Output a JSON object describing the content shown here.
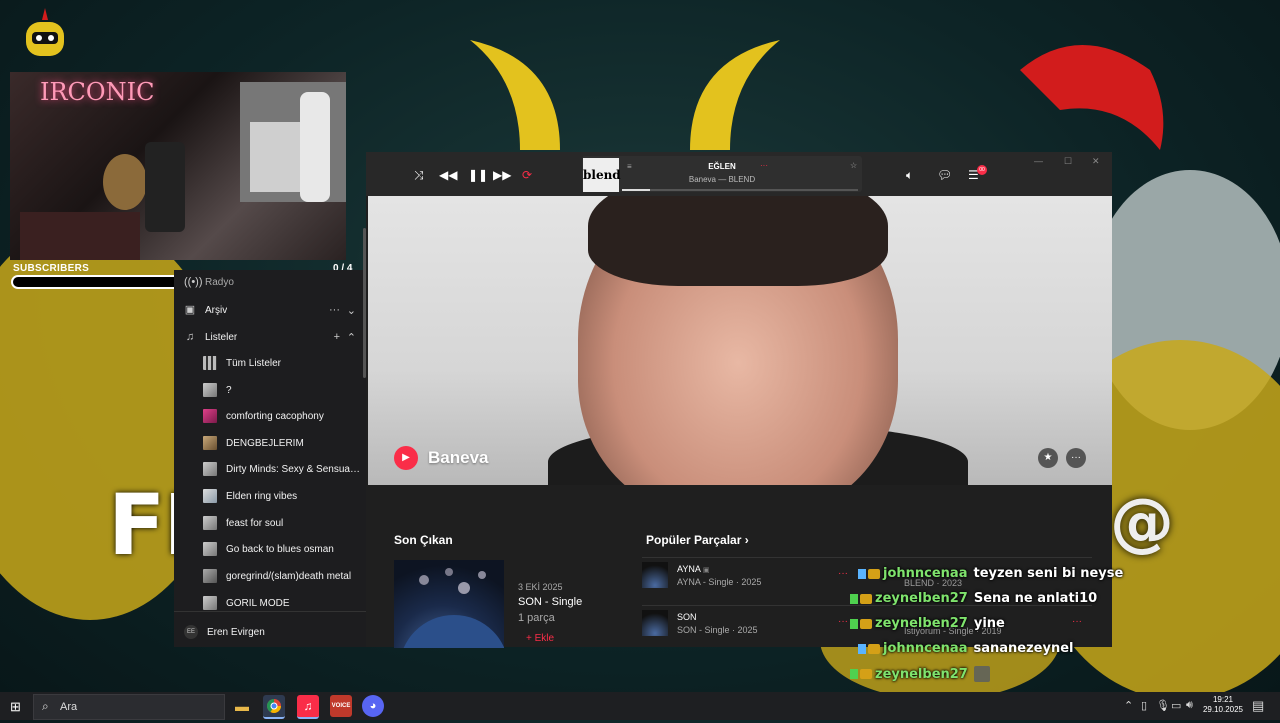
{
  "overlay": {
    "big_letters": "FE",
    "at_sign": "@",
    "cam_neon": "IRCONIC",
    "subscribers_label": "SUBSCRIBERS",
    "subscribers_count": "0 / 4",
    "subscribers_progress": 0
  },
  "sidebar": {
    "radio_label": "Radyo",
    "archive_label": "Arşiv",
    "lists_label": "Listeler",
    "playlists": [
      "Tüm Listeler",
      "?",
      "comforting cacophony",
      "DENGBEJLERİM",
      "Dirty Minds: Sexy & Sensual Pl...",
      "Elden ring vibes",
      "feast for soul",
      "Go back to blues osman",
      "goregrind/(slam)death metal",
      "GORIL MODE"
    ],
    "user_initials": "EE",
    "user_name": "Eren Evirgen"
  },
  "player": {
    "now_playing_art_text": "blend",
    "now_playing_title": "EĞLEN",
    "now_playing_subtitle": "Baneva — BLEND",
    "progress": 0.12,
    "queue_badge": "00"
  },
  "artist": {
    "name": "Baneva"
  },
  "latest": {
    "section_title": "Son Çıkan",
    "date": "3 EKİ 2025",
    "title": "SON - Single",
    "count": "1 parça",
    "add_label": "Ekle"
  },
  "popular": {
    "section_title": "Popüler Parçalar",
    "tracks": [
      {
        "name": "AYNA",
        "sub": "AYNA - Single · 2025",
        "side": "BLEND · 2023"
      },
      {
        "name": "SON",
        "sub": "SON - Single · 2025",
        "side": "İstiyorum - Single · 2019"
      }
    ]
  },
  "chat": [
    {
      "user": "johnncenaa",
      "text": "teyzen seni bi neyse",
      "badge": "#5ab4ff"
    },
    {
      "user": "zeynelben27",
      "text": "Sena ne anlati10",
      "badge": "#4fd14f"
    },
    {
      "user": "zeynelben27",
      "text": "yine",
      "badge": "#4fd14f"
    },
    {
      "user": "johnncenaa",
      "text": "sananezeynel",
      "badge": "#5ab4ff"
    },
    {
      "user": "zeynelben27",
      "text": "",
      "badge": "#4fd14f"
    }
  ],
  "taskbar": {
    "search_placeholder": "Ara",
    "time": "19:21",
    "date": "29.10.2025",
    "app_voice_label": "VOICE"
  },
  "colors": {
    "accent": "#fa2d48",
    "chat_user": "#7fe36d"
  }
}
